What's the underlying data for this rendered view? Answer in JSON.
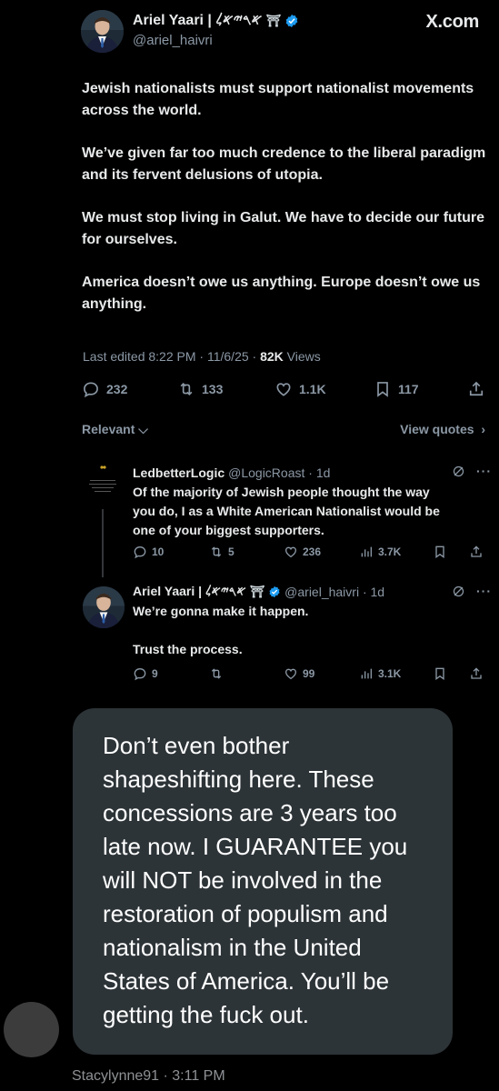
{
  "main_tweet": {
    "author_name": "Ariel Yaari | 𐤀𐤓𐤉𐤀𐤋",
    "shrine_glyph": "⛩",
    "handle": "@ariel_haivri",
    "brand": "X.com",
    "paragraphs": [
      "Jewish nationalists must support nationalist movements across the world.",
      "We’ve given far too much credence to the liberal paradigm and its fervent delusions of utopia.",
      "We must stop living in Galut. We have to decide our future for ourselves.",
      "America doesn’t owe us anything. Europe doesn’t owe us anything."
    ],
    "meta_edited": "Last edited 8:22 PM · 11/6/25 · ",
    "meta_views_count": "82K",
    "meta_views_label": " Views",
    "actions": {
      "replies": "232",
      "reposts": "133",
      "likes": "1.1K",
      "bookmarks": "117"
    },
    "sort_label": "Relevant",
    "view_quotes_label": "View quotes"
  },
  "replies": [
    {
      "name": "LedbetterLogic",
      "handle_time": "@LogicRoast · 1d",
      "text_lines": [
        "Of the majority of Jewish people thought the way",
        "you do, I as a White  American Nationalist would be",
        "one of your biggest supporters."
      ],
      "replies": "10",
      "reposts": "5",
      "likes": "236",
      "views": "3.7K"
    },
    {
      "name": "Ariel Yaari | 𐤀𐤓𐤉𐤀𐤋",
      "shrine_glyph": "⛩",
      "handle_time": "@ariel_haivri · 1d",
      "text_lines": [
        "We’re gonna make it happen.",
        "",
        "Trust the process."
      ],
      "replies": "9",
      "reposts": "",
      "likes": "99",
      "views": "3.1K"
    }
  ],
  "message": {
    "text": "Don’t even bother shapeshifting here. These concessions are 3 years too late now. I GUARANTEE you will NOT be involved in the restoration of populism and nationalism in the United States of America. You’ll be getting the fuck out.",
    "sender_meta": "Stacylynne91 · 3:11 PM"
  },
  "colors": {
    "verified_blue": "#1d9bf0",
    "muted_text": "#8b98a5",
    "bubble_bg": "#2d3438"
  },
  "icons": [
    "verified-icon",
    "reply-icon",
    "repost-icon",
    "like-icon",
    "bookmark-icon",
    "share-icon",
    "views-icon",
    "grok-icon",
    "more-icon",
    "chevron-down-icon",
    "chevron-right-icon"
  ]
}
